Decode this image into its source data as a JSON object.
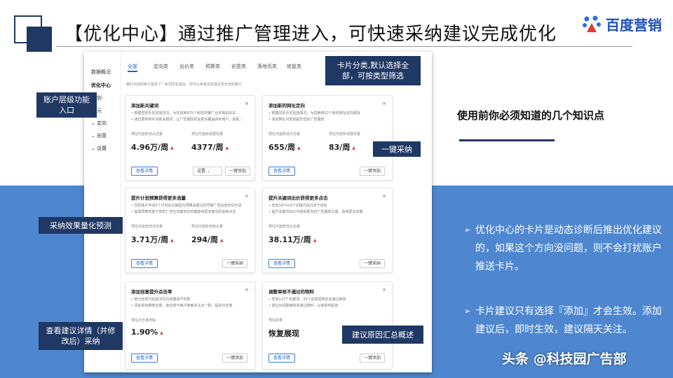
{
  "slide": {
    "title": "【优化中心】通过推广管理进入，可快速采纳建议完成优化",
    "logo_text": "百度营销",
    "knowledge_title": "使用前你必须知道的几个知识点",
    "bullets": [
      "优化中心的卡片是动态诊断后推出优化建议的，如果这个方向没问题，则不会打扰账户推送卡片。",
      "卡片建议只有选择『添加』才会生效。添加建议后，即时生效，建议隔天关注。"
    ],
    "bullet_mark": "➢",
    "watermark": "头条 @科技园广告部",
    "colors": {
      "dark_blue": "#1f3864",
      "band_blue": "#4e87cf",
      "link_blue": "#1e63d8",
      "up_red": "#e03b3b"
    }
  },
  "app": {
    "sidebar": [
      {
        "label": "数据概况"
      },
      {
        "label": "优化中心"
      },
      {
        "label": "划"
      },
      {
        "label": "元"
      },
      {
        "label": "定向"
      },
      {
        "label": "创意"
      },
      {
        "label": "设置"
      }
    ],
    "tabs": [
      "全部",
      "定向类",
      "出价类",
      "预算类",
      "创意类",
      "落地页类",
      "修复类"
    ],
    "hint": "我们为您的账户提供了一系列优化建议，您可以参考这些建议优化您的账户",
    "arrow_up": "▲",
    "close": "×",
    "cards": [
      {
        "title": "添加新关键词",
        "lines": [
          "• 根据您的历史投放情况，为您找到875个和您的推广业务相关的关…",
          "• 通过更新和补充新关键词，让广告展现机会更多覆盖目标用户，获取…"
        ],
        "metrics": [
          {
            "label": "预估可能新增点击量",
            "value": "4.96万/周"
          },
          {
            "label": "预估可能新增展现量",
            "value": "4377/周"
          }
        ],
        "primary": "查看详情",
        "buttons": [
          "设置 ⌄",
          "一键添加"
        ]
      },
      {
        "title": "添加新的网址定向",
        "lines": [
          "• 根据您的历史投放情况，为您推荐52个新的网址定向网址",
          "• 添加网址可有效提升您的广告展现"
        ],
        "metrics": [
          {
            "label": "预估可能新增点击量",
            "value": "655/周"
          },
          {
            "label": "预估可能新增展现量",
            "value": "83/周"
          }
        ],
        "primary": "查看详情",
        "buttons": [
          "一键添加"
        ]
      },
      {
        "title": "提升计划预算获得更多流量",
        "lines": [
          "• 您的账户中有5个计划在近期因为预算设置过低导致广告投放时间不足",
          "• 提高预算有助于您的广告在流量增长时期获得更多曝光机会和点击"
        ],
        "metrics": [
          {
            "label": "预估可能新增点击量",
            "value": "3.71万/周"
          },
          {
            "label": "预估可能新增转化量",
            "value": "294/周"
          }
        ],
        "primary": "查看详情",
        "buttons": [
          "一键采纳"
        ]
      },
      {
        "title": "提升关键词出价获得更多点击",
        "lines": [
          "• 您有187419个关键词出价低于排名",
          "• 提升关键词出价可获得更多的广告展现位置，获得更多流量"
        ],
        "metrics": [
          {
            "label": "预估可能新增点击量",
            "value": "38.11万/周"
          }
        ],
        "primary": "查看详情",
        "buttons": [
          "一键采纳"
        ]
      },
      {
        "title": "添加创意提升点击率",
        "lines": [
          "• 部分创意与投放书写内容描述不匹配",
          "• 添加系统推荐创意，使创意与用户搜索关注点一致，提高点击率"
        ],
        "metrics": [
          {
            "label": "预估点击率增幅",
            "value": "1.90%"
          }
        ],
        "primary": "查看详情",
        "buttons": [
          "一键添加"
        ]
      },
      {
        "title": "调整审核不通过的物料",
        "lines": [
          "• 您有137个关键词，35个创意因规定未通过审核",
          "• 通过对调整审核未通过物料，以免影响投放"
        ],
        "metrics": [
          {
            "label": "预估效果",
            "value": "恢复展现"
          }
        ],
        "primary": "查看详情",
        "buttons": [
          "一键添加"
        ]
      }
    ]
  },
  "callouts": {
    "card_category": "卡片分类,默认选择全部，可按类型筛选",
    "account_entry": "账户层级功能入口",
    "one_click": "一键采纳",
    "effect_forecast": "采纳效果量化预测",
    "view_details": "查看建议详情（并修改后）采纳",
    "reason_summary": "建议原因汇总概述"
  }
}
